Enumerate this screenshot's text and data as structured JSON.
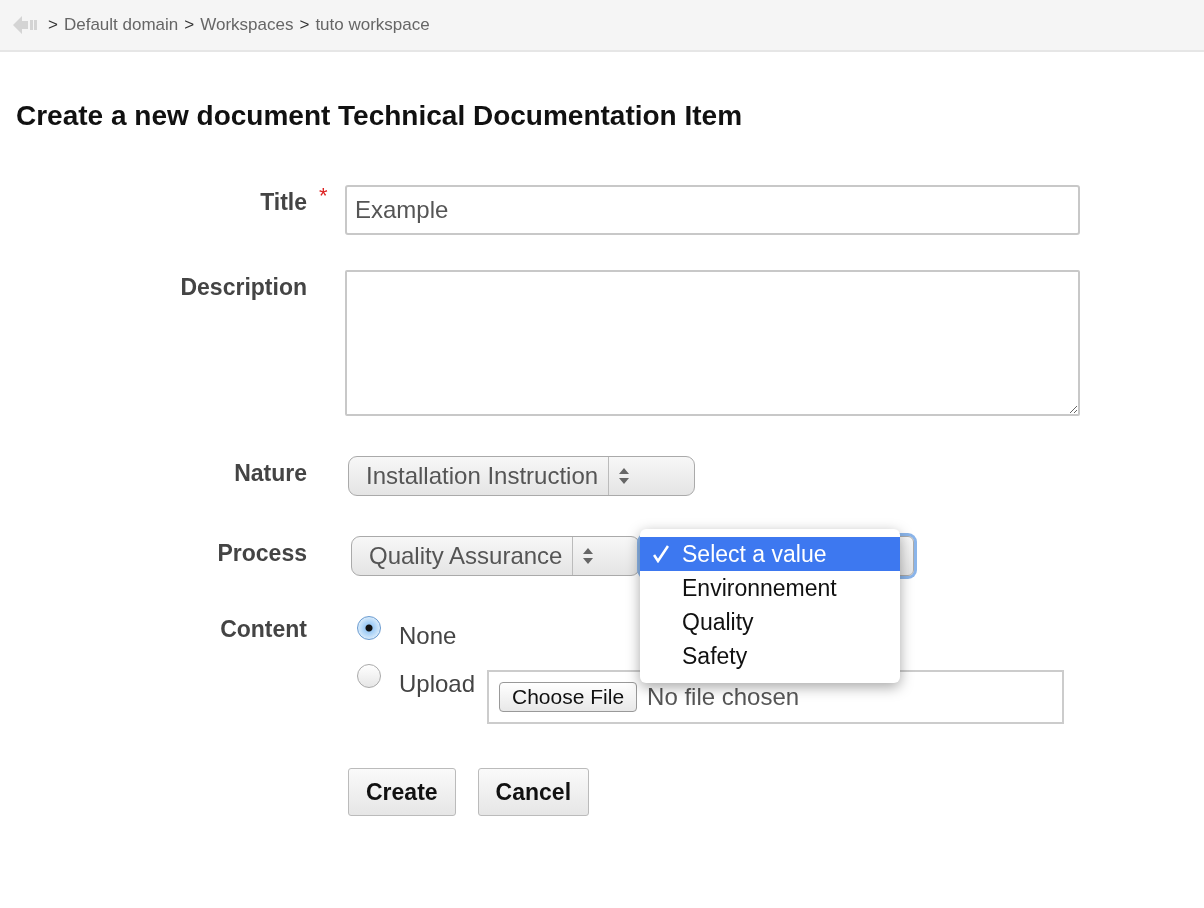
{
  "breadcrumb": {
    "items": [
      {
        "separator": ">",
        "label": "Default domain"
      },
      {
        "separator": ">",
        "label": "Workspaces"
      },
      {
        "separator": ">",
        "label": "tuto workspace"
      }
    ]
  },
  "heading": "Create a new document Technical Documentation Item",
  "fields": [
    {
      "kind": "text",
      "label": "Title",
      "required_mark": "*",
      "value": "Example"
    },
    {
      "kind": "textarea",
      "label": "Description"
    },
    {
      "kind": "select",
      "label": "Nature",
      "value": "Installation Instruction"
    },
    {
      "kind": "cascade",
      "label": "Process",
      "value": "Quality Assurance",
      "expanded": true,
      "options": [
        {
          "label": "Select a value",
          "selected": true
        },
        {
          "label": "Environnement",
          "selected": false
        },
        {
          "label": "Quality",
          "selected": false
        },
        {
          "label": "Safety",
          "selected": false
        }
      ]
    },
    {
      "kind": "radio",
      "label": "Content",
      "options": [
        {
          "label": "None",
          "selected": true
        },
        {
          "label": "Upload",
          "selected": false,
          "file_button": "Choose File",
          "file_status": "No file chosen"
        }
      ]
    }
  ],
  "buttons": [
    "Create",
    "Cancel"
  ]
}
